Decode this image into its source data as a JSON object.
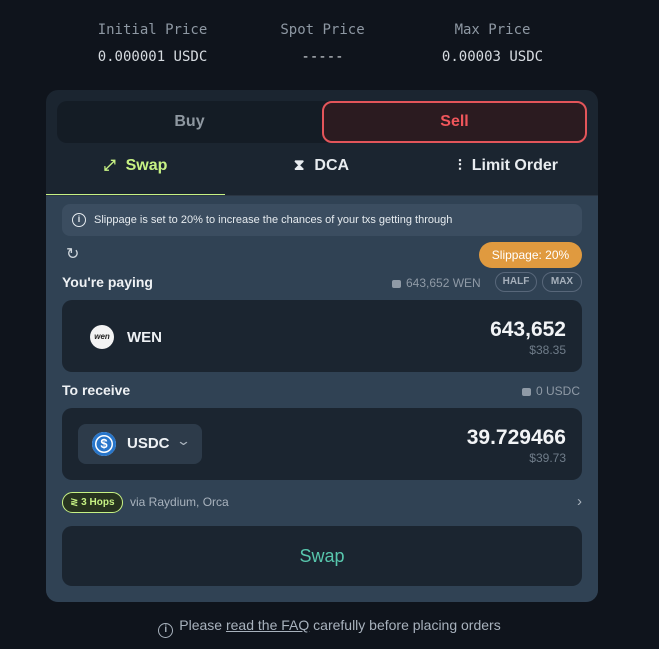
{
  "prices": {
    "initial": {
      "label": "Initial Price",
      "value": "0.000001 USDC"
    },
    "spot": {
      "label": "Spot Price",
      "value": "-----"
    },
    "max": {
      "label": "Max Price",
      "value": "0.00003 USDC"
    }
  },
  "side": {
    "buy_label": "Buy",
    "sell_label": "Sell",
    "selected": "Sell"
  },
  "tabs": [
    {
      "label": "Swap",
      "icon": "swap-arrows-icon"
    },
    {
      "label": "DCA",
      "icon": "hourglass-icon"
    },
    {
      "label": "Limit Order",
      "icon": "candlestick-icon"
    }
  ],
  "notice": "Slippage is set to 20% to increase the chances of your txs getting through",
  "slippage_label": "Slippage: 20%",
  "paying": {
    "label": "You're paying",
    "balance": "643,652 WEN",
    "half_label": "HALF",
    "max_label": "MAX",
    "token": "WEN",
    "token_logo_text": "wen",
    "amount": "643,652",
    "usd": "$38.35"
  },
  "receiving": {
    "label": "To receive",
    "balance": "0 USDC",
    "token": "USDC",
    "amount": "39.729466",
    "usd": "$39.73"
  },
  "route": {
    "hops_label": "3 Hops",
    "via": "via Raydium, Orca"
  },
  "swap_label": "Swap",
  "footer": {
    "pre": "Please",
    "link": "read the FAQ",
    "post": "carefully before placing orders"
  },
  "colors": {
    "accent_green": "#c7f284",
    "sell_red": "#e3555a",
    "slippage_orange": "#e09a3f",
    "usdc_blue": "#2775ca"
  }
}
